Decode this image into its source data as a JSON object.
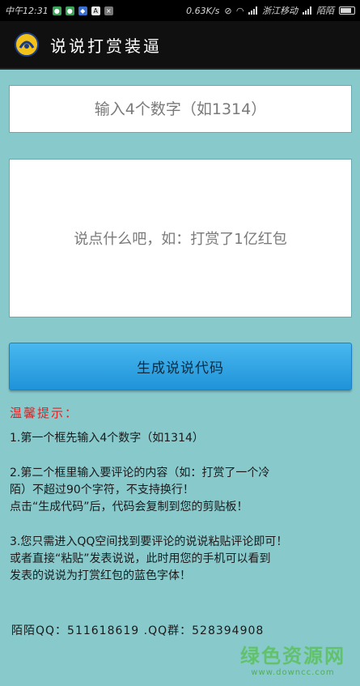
{
  "status_bar": {
    "time": "中午12:31",
    "net_speed": "0.63K/s",
    "carrier1": "浙江移动",
    "carrier2": "陌陌"
  },
  "header": {
    "title": "说说打赏装逼"
  },
  "form": {
    "number_placeholder": "输入4个数字（如1314）",
    "comment_placeholder": "说点什么吧，如：打赏了1亿红包",
    "generate_label": "生成说说代码"
  },
  "tips": {
    "title": "温馨提示：",
    "items": [
      {
        "lines": [
          "1.第一个框先输入4个数字（如1314）"
        ]
      },
      {
        "lines": [
          "2.第二个框里输入要评论的内容（如：打赏了一个冷",
          "陌）不超过90个字符，不支持换行！",
          "点击“生成代码”后，代码会复制到您的剪贴板！"
        ]
      },
      {
        "lines": [
          "3.您只需进入QQ空间找到要评论的说说粘贴评论即可！",
          "或者直接“粘贴”发表说说，此时用您的手机可以看到",
          "发表的说说为打赏红包的蓝色字体！"
        ]
      }
    ],
    "contact": "陌陌QQ：511618619 .QQ群：528394908"
  },
  "watermark": {
    "main": "绿色资源网",
    "sub": "www.downcc.com"
  },
  "colors": {
    "background": "#88c9cc",
    "button": "#2aa3e3",
    "tips_title": "#e62020"
  }
}
